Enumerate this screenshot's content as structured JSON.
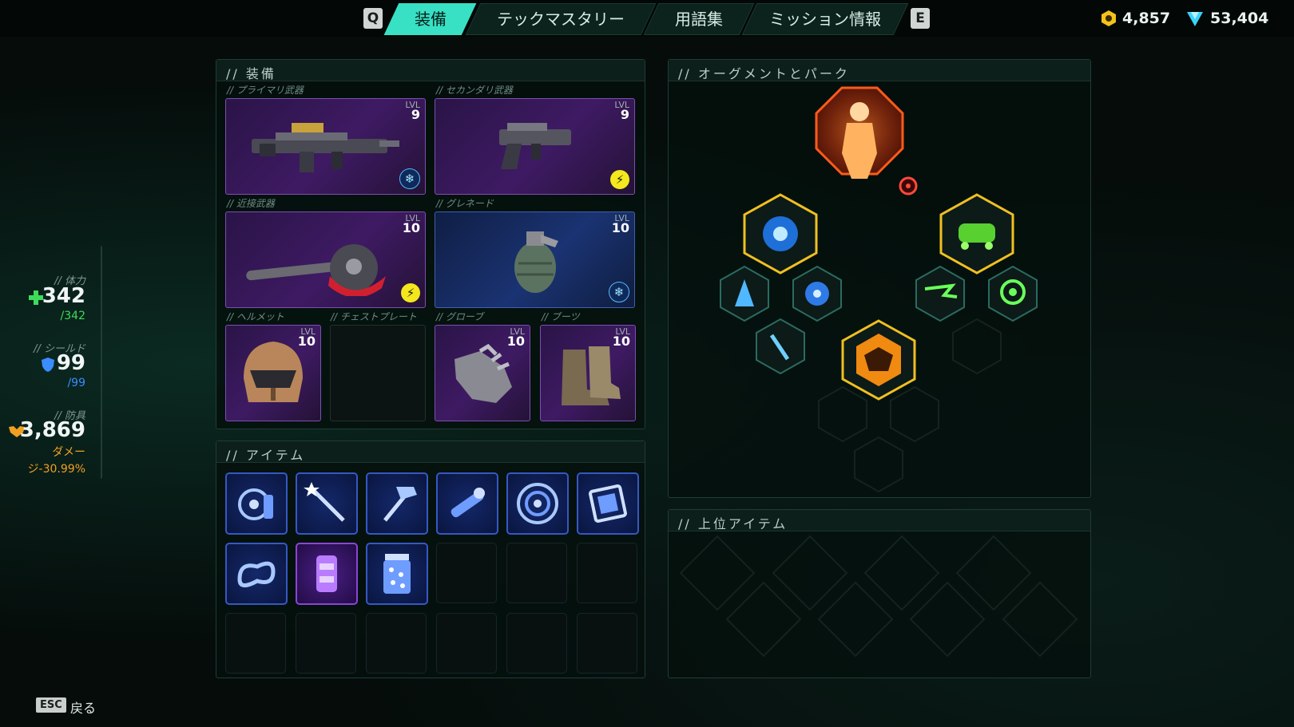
{
  "nav": {
    "prev_key": "Q",
    "next_key": "E",
    "tabs": [
      {
        "label": "装備"
      },
      {
        "label": "テックマスタリー"
      },
      {
        "label": "用語集"
      },
      {
        "label": "ミッション情報"
      }
    ]
  },
  "currency": {
    "gold": "4,857",
    "gems": "53,404"
  },
  "stats": {
    "health": {
      "label": "// 体力",
      "value": "342",
      "max": "/342"
    },
    "shield": {
      "label": "// シールド",
      "value": "99",
      "max": "/99"
    },
    "armor": {
      "label": "// 防具",
      "value": "3,869",
      "sub1": "ダメー",
      "sub2": "ジ-30.99%"
    }
  },
  "equipment": {
    "title": "// 装備",
    "lvl_label": "LVL",
    "primary": {
      "label": "// プライマリ武器",
      "level": "9"
    },
    "secondary": {
      "label": "// セカンダリ武器",
      "level": "9"
    },
    "melee": {
      "label": "// 近接武器",
      "level": "10"
    },
    "grenade": {
      "label": "// グレネード",
      "level": "10"
    },
    "helmet": {
      "label": "// ヘルメット",
      "level": "10"
    },
    "chest": {
      "label": "// チェストプレート"
    },
    "gloves": {
      "label": "// グローブ",
      "level": "10"
    },
    "boots": {
      "label": "// ブーツ",
      "level": "10"
    }
  },
  "items": {
    "title": "// アイテム"
  },
  "augments": {
    "title": "// オーグメントとパーク"
  },
  "top_items": {
    "title": "// 上位アイテム"
  },
  "footer": {
    "esc": "ESC",
    "back": "戻る"
  },
  "colors": {
    "accent": "#38e0c4",
    "frost": "#58b6ff",
    "shock": "#f4e71c",
    "armor": "#f0a020",
    "health": "#3cdc5a",
    "shield": "#3a8cff"
  }
}
